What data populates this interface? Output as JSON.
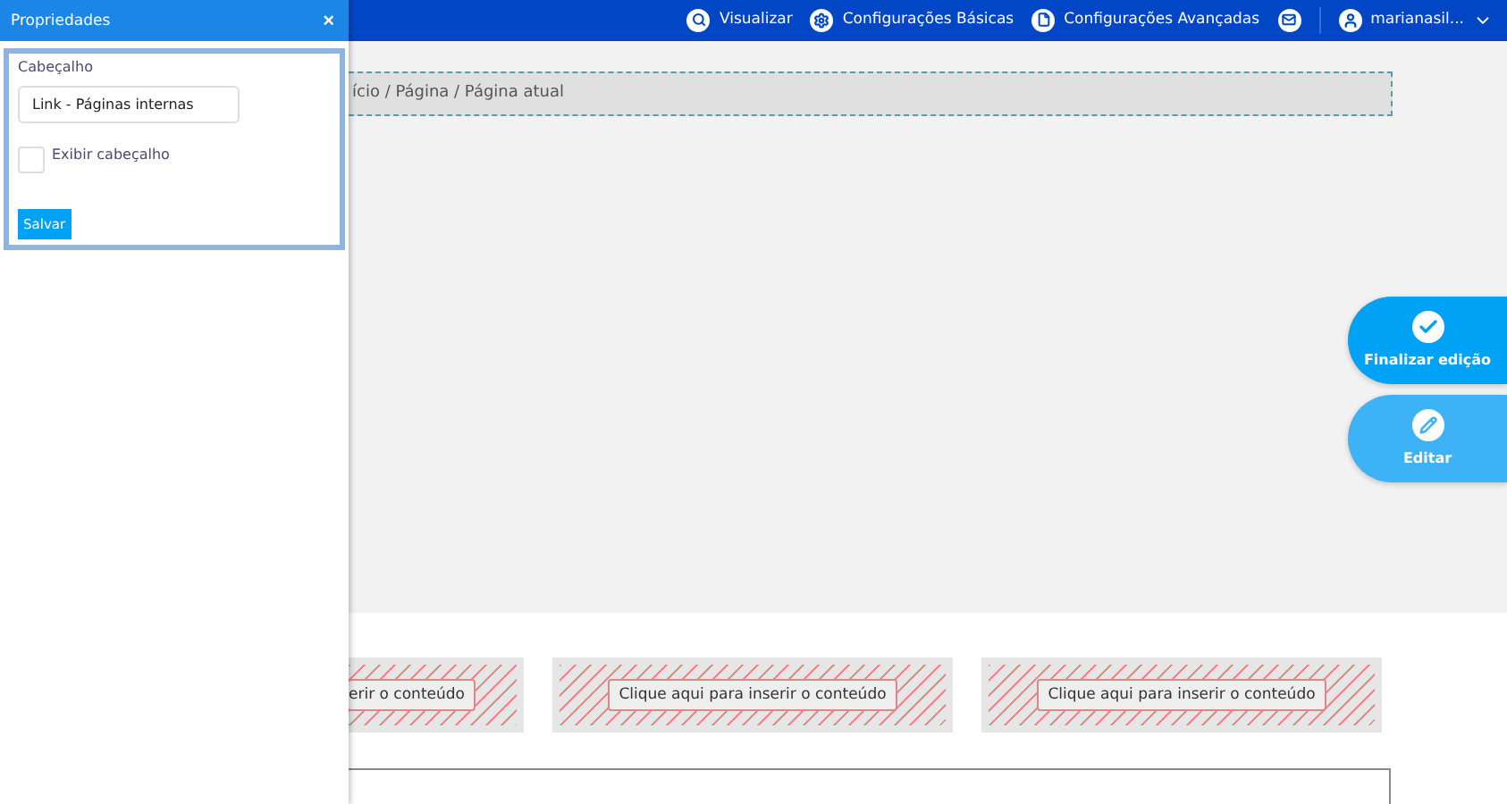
{
  "header": {
    "nav": [
      {
        "kind": "preview",
        "label": "Visualizar"
      },
      {
        "kind": "basic",
        "label": "Configurações Básicas"
      },
      {
        "kind": "advanced",
        "label": "Configurações Avançadas"
      }
    ],
    "user": "marianasil..."
  },
  "breadcrumb": "ício / Página / Página atual",
  "content_blocks": [
    "erir o conteúdo",
    "Clique aqui para inserir o conteúdo",
    "Clique aqui para inserir o conteúdo"
  ],
  "floating_buttons": [
    {
      "kind": "finish",
      "label": "Finalizar edição"
    },
    {
      "kind": "edit",
      "label": "Editar"
    }
  ],
  "panel": {
    "title": "Propriedades",
    "close": "×",
    "section": "Cabeçalho",
    "field_value": "Link - Páginas internas",
    "checkbox": {
      "label": "Exibir cabeçalho",
      "checked": false
    },
    "save": "Salvar"
  }
}
